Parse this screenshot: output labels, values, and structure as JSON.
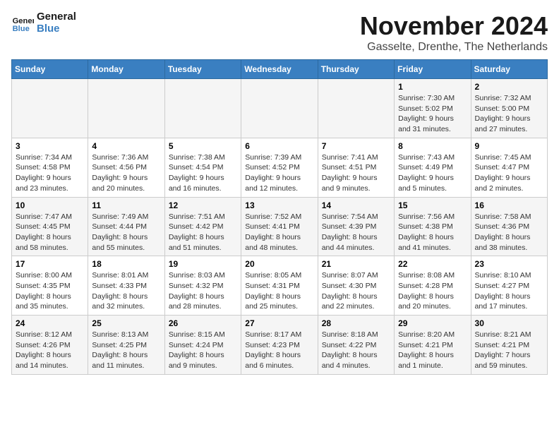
{
  "header": {
    "logo_line1": "General",
    "logo_line2": "Blue",
    "month_title": "November 2024",
    "location": "Gasselte, Drenthe, The Netherlands"
  },
  "weekdays": [
    "Sunday",
    "Monday",
    "Tuesday",
    "Wednesday",
    "Thursday",
    "Friday",
    "Saturday"
  ],
  "weeks": [
    [
      {
        "day": "",
        "info": ""
      },
      {
        "day": "",
        "info": ""
      },
      {
        "day": "",
        "info": ""
      },
      {
        "day": "",
        "info": ""
      },
      {
        "day": "",
        "info": ""
      },
      {
        "day": "1",
        "info": "Sunrise: 7:30 AM\nSunset: 5:02 PM\nDaylight: 9 hours and 31 minutes."
      },
      {
        "day": "2",
        "info": "Sunrise: 7:32 AM\nSunset: 5:00 PM\nDaylight: 9 hours and 27 minutes."
      }
    ],
    [
      {
        "day": "3",
        "info": "Sunrise: 7:34 AM\nSunset: 4:58 PM\nDaylight: 9 hours and 23 minutes."
      },
      {
        "day": "4",
        "info": "Sunrise: 7:36 AM\nSunset: 4:56 PM\nDaylight: 9 hours and 20 minutes."
      },
      {
        "day": "5",
        "info": "Sunrise: 7:38 AM\nSunset: 4:54 PM\nDaylight: 9 hours and 16 minutes."
      },
      {
        "day": "6",
        "info": "Sunrise: 7:39 AM\nSunset: 4:52 PM\nDaylight: 9 hours and 12 minutes."
      },
      {
        "day": "7",
        "info": "Sunrise: 7:41 AM\nSunset: 4:51 PM\nDaylight: 9 hours and 9 minutes."
      },
      {
        "day": "8",
        "info": "Sunrise: 7:43 AM\nSunset: 4:49 PM\nDaylight: 9 hours and 5 minutes."
      },
      {
        "day": "9",
        "info": "Sunrise: 7:45 AM\nSunset: 4:47 PM\nDaylight: 9 hours and 2 minutes."
      }
    ],
    [
      {
        "day": "10",
        "info": "Sunrise: 7:47 AM\nSunset: 4:45 PM\nDaylight: 8 hours and 58 minutes."
      },
      {
        "day": "11",
        "info": "Sunrise: 7:49 AM\nSunset: 4:44 PM\nDaylight: 8 hours and 55 minutes."
      },
      {
        "day": "12",
        "info": "Sunrise: 7:51 AM\nSunset: 4:42 PM\nDaylight: 8 hours and 51 minutes."
      },
      {
        "day": "13",
        "info": "Sunrise: 7:52 AM\nSunset: 4:41 PM\nDaylight: 8 hours and 48 minutes."
      },
      {
        "day": "14",
        "info": "Sunrise: 7:54 AM\nSunset: 4:39 PM\nDaylight: 8 hours and 44 minutes."
      },
      {
        "day": "15",
        "info": "Sunrise: 7:56 AM\nSunset: 4:38 PM\nDaylight: 8 hours and 41 minutes."
      },
      {
        "day": "16",
        "info": "Sunrise: 7:58 AM\nSunset: 4:36 PM\nDaylight: 8 hours and 38 minutes."
      }
    ],
    [
      {
        "day": "17",
        "info": "Sunrise: 8:00 AM\nSunset: 4:35 PM\nDaylight: 8 hours and 35 minutes."
      },
      {
        "day": "18",
        "info": "Sunrise: 8:01 AM\nSunset: 4:33 PM\nDaylight: 8 hours and 32 minutes."
      },
      {
        "day": "19",
        "info": "Sunrise: 8:03 AM\nSunset: 4:32 PM\nDaylight: 8 hours and 28 minutes."
      },
      {
        "day": "20",
        "info": "Sunrise: 8:05 AM\nSunset: 4:31 PM\nDaylight: 8 hours and 25 minutes."
      },
      {
        "day": "21",
        "info": "Sunrise: 8:07 AM\nSunset: 4:30 PM\nDaylight: 8 hours and 22 minutes."
      },
      {
        "day": "22",
        "info": "Sunrise: 8:08 AM\nSunset: 4:28 PM\nDaylight: 8 hours and 20 minutes."
      },
      {
        "day": "23",
        "info": "Sunrise: 8:10 AM\nSunset: 4:27 PM\nDaylight: 8 hours and 17 minutes."
      }
    ],
    [
      {
        "day": "24",
        "info": "Sunrise: 8:12 AM\nSunset: 4:26 PM\nDaylight: 8 hours and 14 minutes."
      },
      {
        "day": "25",
        "info": "Sunrise: 8:13 AM\nSunset: 4:25 PM\nDaylight: 8 hours and 11 minutes."
      },
      {
        "day": "26",
        "info": "Sunrise: 8:15 AM\nSunset: 4:24 PM\nDaylight: 8 hours and 9 minutes."
      },
      {
        "day": "27",
        "info": "Sunrise: 8:17 AM\nSunset: 4:23 PM\nDaylight: 8 hours and 6 minutes."
      },
      {
        "day": "28",
        "info": "Sunrise: 8:18 AM\nSunset: 4:22 PM\nDaylight: 8 hours and 4 minutes."
      },
      {
        "day": "29",
        "info": "Sunrise: 8:20 AM\nSunset: 4:21 PM\nDaylight: 8 hours and 1 minute."
      },
      {
        "day": "30",
        "info": "Sunrise: 8:21 AM\nSunset: 4:21 PM\nDaylight: 7 hours and 59 minutes."
      }
    ]
  ]
}
